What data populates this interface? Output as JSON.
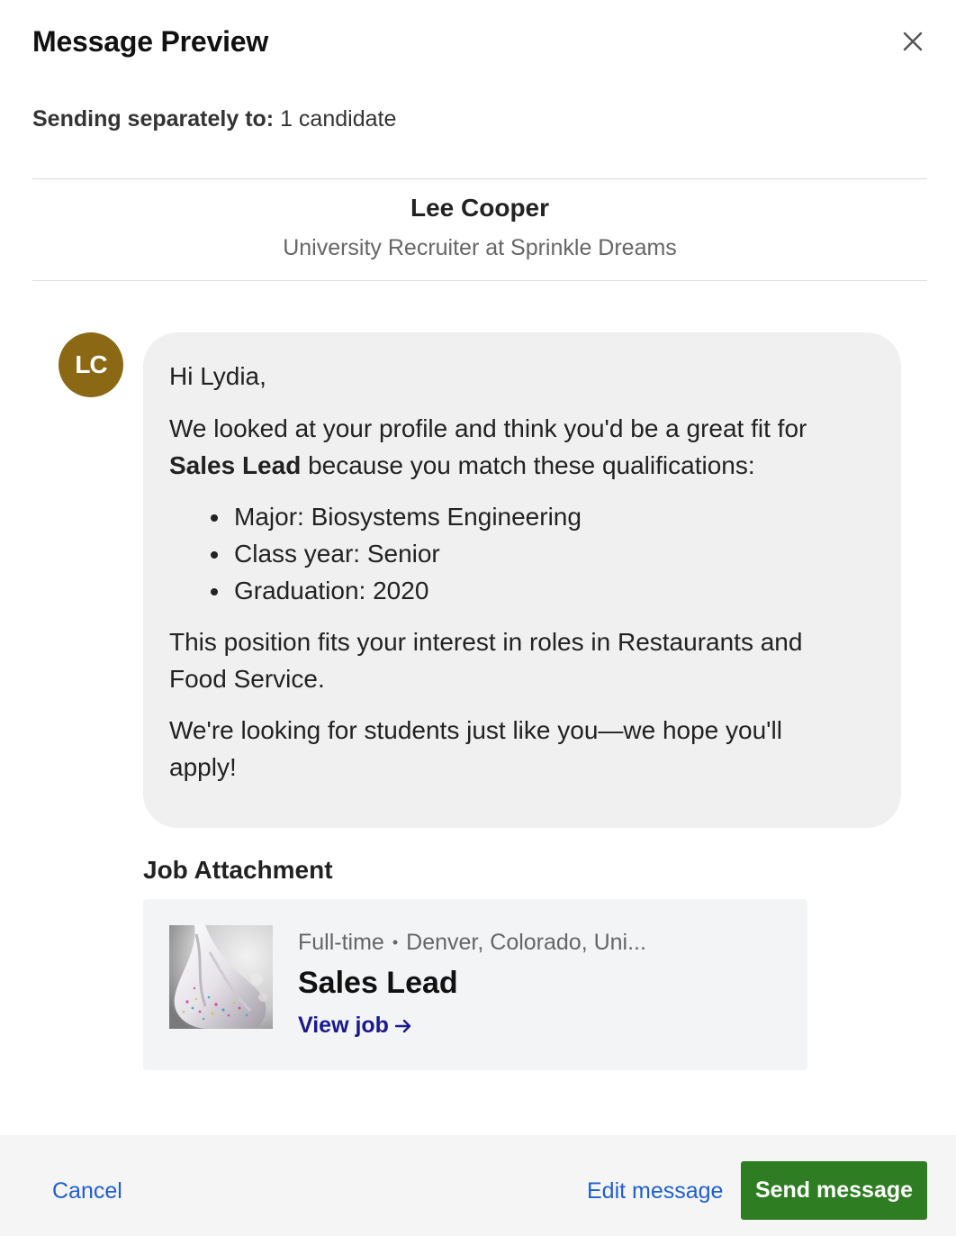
{
  "modal": {
    "title": "Message Preview",
    "close_icon": "close-icon"
  },
  "sending": {
    "label": "Sending separately to:",
    "value": "1 candidate"
  },
  "recipient": {
    "name": "Lee Cooper",
    "title": "University Recruiter at Sprinkle Dreams"
  },
  "avatar": {
    "initials": "LC",
    "color": "#8b6914"
  },
  "message": {
    "greeting": "Hi Lydia,",
    "intro_before": "We looked at your profile and think you'd be a great fit for ",
    "intro_bold": "Sales Lead",
    "intro_after": " because you match these qualifications:",
    "qualifications": [
      "Major: Biosystems Engineering",
      "Class year: Senior",
      "Graduation: 2020"
    ],
    "interest": "This position fits your interest in roles in Restaurants and Food Service.",
    "closing": "We're looking for students just like you—we hope you'll apply!"
  },
  "attachment": {
    "heading": "Job Attachment",
    "job_type": "Full-time",
    "separator": "•",
    "location": "Denver, Colorado, Uni...",
    "title": "Sales Lead",
    "view_label": "View job",
    "arrow_icon": "arrow-right-icon"
  },
  "footer": {
    "cancel_label": "Cancel",
    "edit_label": "Edit message",
    "send_label": "Send message",
    "link_color": "#1f5fcf",
    "send_color": "#2e7d22"
  }
}
